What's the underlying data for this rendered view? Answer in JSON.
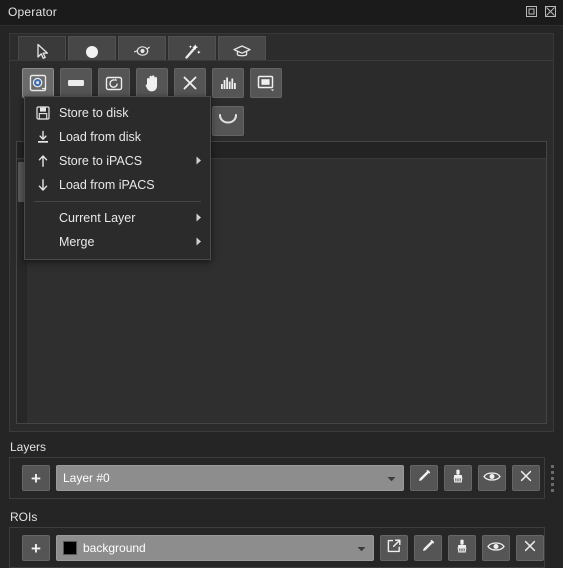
{
  "window": {
    "title": "Operator",
    "controls": [
      {
        "name": "restore-window-button",
        "glyph": "restore"
      },
      {
        "name": "close-window-button",
        "glyph": "close"
      }
    ]
  },
  "tabs": [
    {
      "icon": "cursor-arrow-icon",
      "label": "Select",
      "active": true
    },
    {
      "icon": "filled-circle-icon",
      "label": "Paint",
      "active": false
    },
    {
      "icon": "eye-lasso-icon",
      "label": "Inspect",
      "active": false
    },
    {
      "icon": "magic-wand-icon",
      "label": "Magic Wand",
      "active": false
    },
    {
      "icon": "graduation-cap-icon",
      "label": "Training",
      "active": false
    }
  ],
  "toolbar": {
    "primary": [
      {
        "icon": "save-image-icon",
        "label": "Store / Load",
        "active": true,
        "marker": false
      },
      {
        "icon": "rectangle-icon",
        "label": "Rectangle",
        "active": false,
        "marker": false
      },
      {
        "icon": "reset-camera-icon",
        "label": "Reset View",
        "active": false,
        "marker": false
      },
      {
        "icon": "hand-pan-icon",
        "label": "Pan",
        "active": false,
        "marker": false
      },
      {
        "icon": "close-x-icon",
        "label": "Clear",
        "active": false,
        "marker": true
      },
      {
        "icon": "histogram-icon",
        "label": "Histogram",
        "active": false,
        "marker": false
      },
      {
        "icon": "window-level-icon",
        "label": "Window/Level",
        "active": false,
        "marker": false
      }
    ],
    "secondary": [
      {
        "icon": "curve-smile-icon",
        "label": "Curve",
        "active": false
      }
    ]
  },
  "context_menu": {
    "items": [
      {
        "icon": "floppy-disk-icon",
        "label": "Store to disk",
        "submenu": false,
        "separator_after": false
      },
      {
        "icon": "download-tray-icon",
        "label": "Load from disk",
        "submenu": false,
        "separator_after": false
      },
      {
        "icon": "arrow-up-icon",
        "label": "Store to iPACS",
        "submenu": true,
        "separator_after": false
      },
      {
        "icon": "arrow-down-icon",
        "label": "Load from iPACS",
        "submenu": false,
        "separator_after": true
      },
      {
        "icon": "",
        "label": "Current Layer",
        "submenu": true,
        "separator_after": false
      },
      {
        "icon": "",
        "label": "Merge",
        "submenu": true,
        "separator_after": false
      }
    ]
  },
  "layers": {
    "title": "Layers",
    "add_label": "+",
    "selected": "Layer #0",
    "actions": [
      {
        "icon": "pencil-icon",
        "name": "edit-layer-button"
      },
      {
        "icon": "brush-icon",
        "name": "paint-layer-button"
      },
      {
        "icon": "eye-icon",
        "name": "toggle-layer-visibility-button"
      },
      {
        "icon": "close-x-icon",
        "name": "delete-layer-button"
      }
    ]
  },
  "rois": {
    "title": "ROIs",
    "add_label": "+",
    "selected": "background",
    "swatch_color": "#000000",
    "actions": [
      {
        "icon": "external-link-icon",
        "name": "export-roi-button"
      },
      {
        "icon": "pencil-icon",
        "name": "edit-roi-button"
      },
      {
        "icon": "brush-icon",
        "name": "paint-roi-button"
      },
      {
        "icon": "eye-icon",
        "name": "toggle-roi-visibility-button"
      },
      {
        "icon": "close-x-icon",
        "name": "delete-roi-button"
      }
    ]
  },
  "colors": {
    "background": "#252525",
    "titlebar": "#1b1b1b",
    "panel": "#2b2b2b",
    "button": "#555555",
    "combo": "#8d8d8d",
    "marker_yellow": "#80761c",
    "accent_blue": "#3b6fb5"
  }
}
